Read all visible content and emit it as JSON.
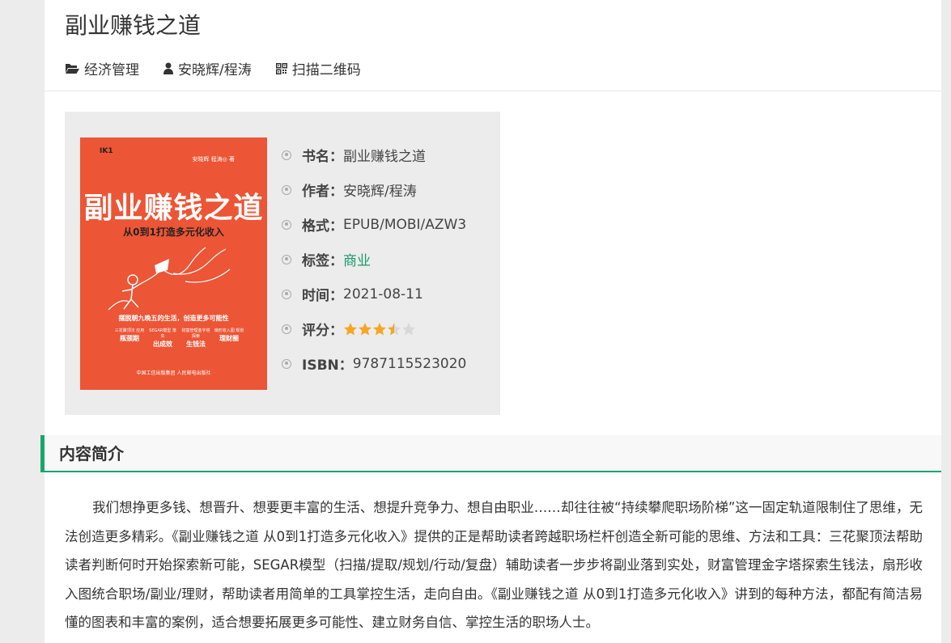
{
  "book": {
    "title": "副业赚钱之道"
  },
  "meta": {
    "category": "经济管理",
    "authors": "安晓辉/程涛",
    "qrcode": "扫描二维码"
  },
  "cover": {
    "logo": "IK1",
    "authors": "安晓辉  程涛◎  著",
    "title": "副业赚钱之道",
    "subtitle": "从0到1打造多元化收入",
    "tagline": "摆脱朝九晚五的生活，创造更多可能性",
    "tools": [
      {
        "small": "三花聚顶法 应用",
        "big": "瓶颈期"
      },
      {
        "small": "SEGAR模型 落实",
        "big": "出成效"
      },
      {
        "small": "财富管理金字塔 探索",
        "big": "生钱法"
      },
      {
        "small": "扇形收入图 规划",
        "big": "理财圈"
      }
    ],
    "publishers": "中国工信出版集团   人民邮电出版社"
  },
  "info": {
    "name_label": "书名：",
    "name_value": "副业赚钱之道",
    "author_label": "作者：",
    "author_value": "安晓辉/程涛",
    "format_label": "格式：",
    "format_value": "EPUB/MOBI/AZW3",
    "tag_label": "标签：",
    "tag_value": "商业",
    "time_label": "时间：",
    "time_value": "2021-08-11",
    "rating_label": "评分：",
    "rating_value": 3.5,
    "rating_max": 5,
    "isbn_label": "ISBN：",
    "isbn_value": "9787115523020"
  },
  "section": {
    "title": "内容简介"
  },
  "intro": {
    "text": "我们想挣更多钱、想晋升、想要更丰富的生活、想提升竞争力、想自由职业……却往往被“持续攀爬职场阶梯”这一固定轨道限制住了思维，无法创造更多精彩。《副业赚钱之道 从0到1打造多元化收入》提供的正是帮助读者跨越职场栏杆创造全新可能的思维、方法和工具：三花聚顶法帮助读者判断何时开始探索新可能，SEGAR模型（扫描/提取/规划/行动/复盘）辅助读者一步步将副业落到实处，财富管理金字塔探索生钱法，扇形收入图统合职场/副业/理财，帮助读者用简单的工具掌控生活，走向自由。《副业赚钱之道 从0到1打造多元化收入》讲到的每种方法，都配有简洁易懂的图表和丰富的案例，适合想要拓展更多可能性、建立财务自信、掌控生活的职场人士。"
  },
  "colors": {
    "accent": "#1aa56f",
    "cover": "#ec5535",
    "star": "#f5a623"
  }
}
